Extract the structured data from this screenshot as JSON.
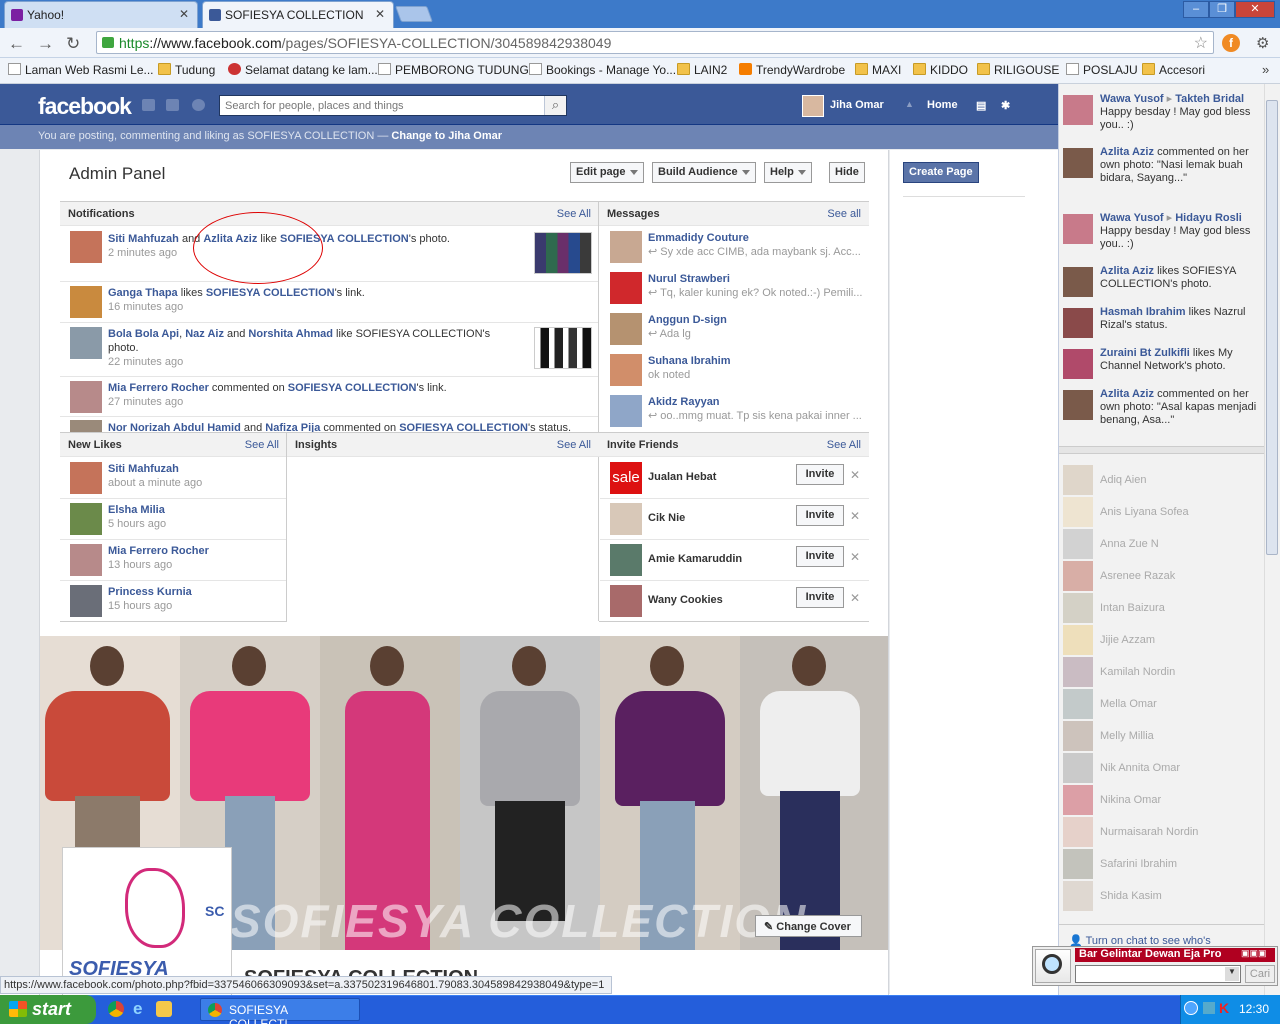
{
  "browser": {
    "tabs": [
      {
        "label": "Yahoo!"
      },
      {
        "label": "SOFIESYA COLLECTION"
      }
    ],
    "url_scheme": "https",
    "url_host": "://www.facebook.com",
    "url_path": "/pages/SOFIESYA-COLLECTION/304589842938049",
    "bookmarks": [
      "Laman Web Rasmi Le...",
      "Tudung",
      "Selamat datang ke lam...",
      "PEMBORONG TUDUNG...",
      "Bookings - Manage Yo...",
      "LAIN2",
      "TrendyWardrobe",
      "MAXI",
      "KIDDO",
      "RILIGOUSE",
      "POSLAJU",
      "Accesori"
    ]
  },
  "fb": {
    "logo": "facebook",
    "search_placeholder": "Search for people, places and things",
    "user_name": "Jiha Omar",
    "home_label": "Home",
    "posting_text": "You are posting, commenting and liking as SOFIESYA COLLECTION —",
    "posting_switch": "Change to Jiha Omar"
  },
  "admin": {
    "title": "Admin Panel",
    "edit_page": "Edit page",
    "build_audience": "Build Audience",
    "help": "Help",
    "hide": "Hide",
    "create_page": "Create Page"
  },
  "notifications": {
    "header": "Notifications",
    "see_all": "See All",
    "items": [
      {
        "a": "Siti Mahfuzah",
        "mid": " and ",
        "b": "Azlita Aziz",
        "verb": " like ",
        "page": "SOFIESYA COLLECTION",
        "tail": "'s photo.",
        "time": "2 minutes ago"
      },
      {
        "a": "Ganga Thapa",
        "mid": " likes ",
        "b": "SOFIESYA COLLECTION",
        "verb": "",
        "page": "",
        "tail": "'s link.",
        "time": "16 minutes ago"
      },
      {
        "a": "Bola Bola Api",
        "mid": ", ",
        "b": "Naz Aiz",
        "verb": " and ",
        "page": "Norshita Ahmad",
        "tail": " like SOFIESYA COLLECTION's photo.",
        "time": "22 minutes ago"
      },
      {
        "a": "Mia Ferrero Rocher",
        "mid": " commented on ",
        "b": "SOFIESYA COLLECTION",
        "verb": "",
        "page": "",
        "tail": "'s link.",
        "time": "27 minutes ago"
      },
      {
        "a": "Nor Norizah Abdul Hamid",
        "mid": " and ",
        "b": "Nafiza Pija",
        "verb": " commented on ",
        "page": "SOFIESYA COLLECTION",
        "tail": "'s status.",
        "time": ""
      }
    ]
  },
  "messages": {
    "header": "Messages",
    "see_all": "See all",
    "items": [
      {
        "name": "Emmadidy Couture",
        "text": "Sy xde acc CIMB, ada maybank sj. Acc..."
      },
      {
        "name": "Nurul Strawberi",
        "text": "Tq, kaler kuning ek? Ok noted.:-) Pemili..."
      },
      {
        "name": "Anggun D-sign",
        "text": "Ada lg"
      },
      {
        "name": "Suhana Ibrahim",
        "text": "ok noted"
      },
      {
        "name": "Akidz Rayyan",
        "text": "oo..mmg muat. Tp sis kena pakai inner ..."
      }
    ]
  },
  "new_likes": {
    "header": "New Likes",
    "see_all": "See All",
    "items": [
      {
        "name": "Siti Mahfuzah",
        "time": "about a minute ago"
      },
      {
        "name": "Elsha Milia",
        "time": "5 hours ago"
      },
      {
        "name": "Mia Ferrero Rocher",
        "time": "13 hours ago"
      },
      {
        "name": "Princess Kurnia",
        "time": "15 hours ago"
      }
    ]
  },
  "insights": {
    "header": "Insights",
    "see_all": "See All"
  },
  "invite": {
    "header": "Invite Friends",
    "see_all": "See All",
    "button": "Invite",
    "items": [
      "Jualan Hebat",
      "Cik Nie",
      "Amie Kamaruddin",
      "Wany Cookies"
    ]
  },
  "cover": {
    "text": "SOFIESYA COLLECTION",
    "change_cover": "Change Cover",
    "profile_logo": "SOFIESYA",
    "profile_sc": "SC",
    "page_name": "SOFIESYA COLLECTION"
  },
  "status_url": "https://www.facebook.com/photo.php?fbid=337546066309093&set=a.337502319646801.79083.304589842938049&type=1",
  "ticker": [
    {
      "a": "Wawa Yusof",
      "b": "Takteh Bridal",
      "text": "Happy besday ! May god bless you.. :)"
    },
    {
      "a": "Azlita Aziz",
      "b": "",
      "text": "commented on her own photo: \"Nasi lemak buah bidara, Sayang...\""
    },
    {
      "a": "Wawa Yusof",
      "b": "Hidayu Rosli",
      "text": "Happy besday ! May god bless you.. :)"
    },
    {
      "a": "Azlita Aziz",
      "b": "",
      "text": "likes SOFIESYA COLLECTION's photo."
    },
    {
      "a": "Hasmah Ibrahim",
      "b": "",
      "text": "likes Nazrul Rizal's status."
    },
    {
      "a": "Zuraini Bt Zulkifli",
      "b": "",
      "text": "likes My Channel Network's photo."
    },
    {
      "a": "Azlita Aziz",
      "b": "",
      "text": "commented on her own photo: \"Asal kapas menjadi benang, Asa...\""
    }
  ],
  "chat": [
    "Adiq Aien",
    "Anis Liyana Sofea",
    "Anna Zue N",
    "Asrenee Razak",
    "Intan Baizura",
    "Jijie Azzam",
    "Kamilah Nordin",
    "Mella Omar",
    "Melly Millia",
    "Nik Annita Omar",
    "Nikina Omar",
    "Nurmaisarah Nordin",
    "Safarini Ibrahim",
    "Shida Kasim"
  ],
  "chat_footer": "Turn on chat to see who's",
  "dewan": {
    "title": "Bar Gelintar Dewan Eja Pro",
    "button": "Cari"
  },
  "taskbar": {
    "start": "start",
    "item": "SOFIESYA COLLECTI...",
    "clock": "12:30"
  },
  "colors": {
    "fb_blue": "#3b5998",
    "chrome_blue": "#3d7ac9",
    "xp_blue": "#245edb"
  }
}
